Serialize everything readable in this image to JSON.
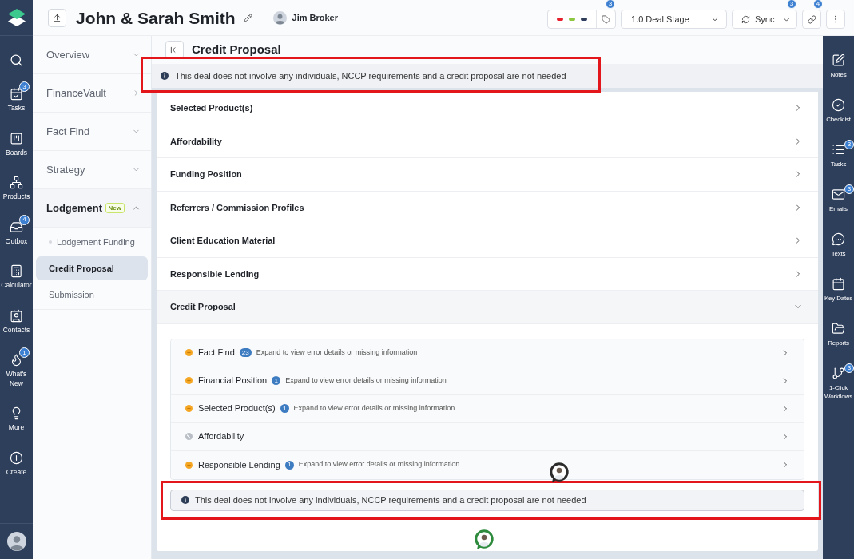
{
  "left_nav": {
    "items": [
      {
        "label": "Tasks",
        "badge": "3"
      },
      {
        "label": "Boards"
      },
      {
        "label": "Products"
      },
      {
        "label": "Outbox",
        "badge": "4"
      },
      {
        "label": "Calculator"
      },
      {
        "label": "Contacts"
      },
      {
        "label": "What's New",
        "badge": "1"
      },
      {
        "label": "More"
      },
      {
        "label": "Create"
      }
    ]
  },
  "header": {
    "title": "John & Sarah Smith",
    "owner": "Jim Broker",
    "tag_dots": [
      {
        "color": "#e8202e"
      },
      {
        "color": "#8dc63f"
      },
      {
        "color": "#2f3e5b"
      }
    ],
    "tag_badge": "3",
    "stage": "1.0 Deal Stage",
    "sync": "Sync",
    "sync_badge": "3",
    "link_badge": "4"
  },
  "sidebar": {
    "items": [
      {
        "label": "Overview",
        "kind": "section",
        "expanded": false
      },
      {
        "label": "FinanceVault",
        "kind": "link",
        "expanded": false
      },
      {
        "label": "Fact Find",
        "kind": "section",
        "expanded": false
      },
      {
        "label": "Strategy",
        "kind": "section",
        "expanded": false
      },
      {
        "label": "Lodgement",
        "kind": "section",
        "badge": "New",
        "expanded": true,
        "children": [
          {
            "label": "Lodgement Funding",
            "bullet": true,
            "selected": false
          },
          {
            "label": "Credit Proposal",
            "bullet": false,
            "selected": true
          },
          {
            "label": "Submission",
            "bullet": false,
            "selected": false
          }
        ]
      }
    ]
  },
  "page": {
    "title": "Credit Proposal",
    "banner": {
      "text": "This deal does not involve any individuals, NCCP requirements and a credit proposal are not needed",
      "highlighted": true
    },
    "sections": [
      {
        "label": "Selected Product(s)",
        "expanded": false
      },
      {
        "label": "Affordability",
        "expanded": false
      },
      {
        "label": "Funding Position",
        "expanded": false
      },
      {
        "label": "Referrers / Commission Profiles",
        "expanded": false
      },
      {
        "label": "Client Education Material",
        "expanded": false
      },
      {
        "label": "Responsible Lending",
        "expanded": false
      },
      {
        "label": "Credit Proposal",
        "expanded": true,
        "checks": [
          {
            "label": "Fact Find",
            "kind": "warning",
            "count": "23",
            "note": "Expand to view error details or missing information"
          },
          {
            "label": "Financial Position",
            "kind": "warning",
            "count": "1",
            "note": "Expand to view error details or missing information"
          },
          {
            "label": "Selected Product(s)",
            "kind": "warning",
            "count": "1",
            "note": "Expand to view error details or missing information"
          },
          {
            "label": "Affordability",
            "kind": "not_applicable"
          },
          {
            "label": "Responsible Lending",
            "kind": "warning",
            "count": "1",
            "note": "Expand to view error details or missing information"
          }
        ],
        "notice": {
          "text": "This deal does not involve any individuals, NCCP requirements and a credit proposal are not needed",
          "highlighted": true
        }
      }
    ],
    "pins": [
      {
        "color": "#2b2b2b"
      },
      {
        "color": "#2e8b3e"
      }
    ]
  },
  "right_nav": {
    "items": [
      {
        "label": "Notes"
      },
      {
        "label": "Checklist"
      },
      {
        "label": "Tasks",
        "badge": "3"
      },
      {
        "label": "Emails",
        "badge": "3"
      },
      {
        "label": "Texts"
      },
      {
        "label": "Key Dates"
      },
      {
        "label": "Reports"
      },
      {
        "label": "1-Click Workflows",
        "badge": "3"
      }
    ]
  }
}
